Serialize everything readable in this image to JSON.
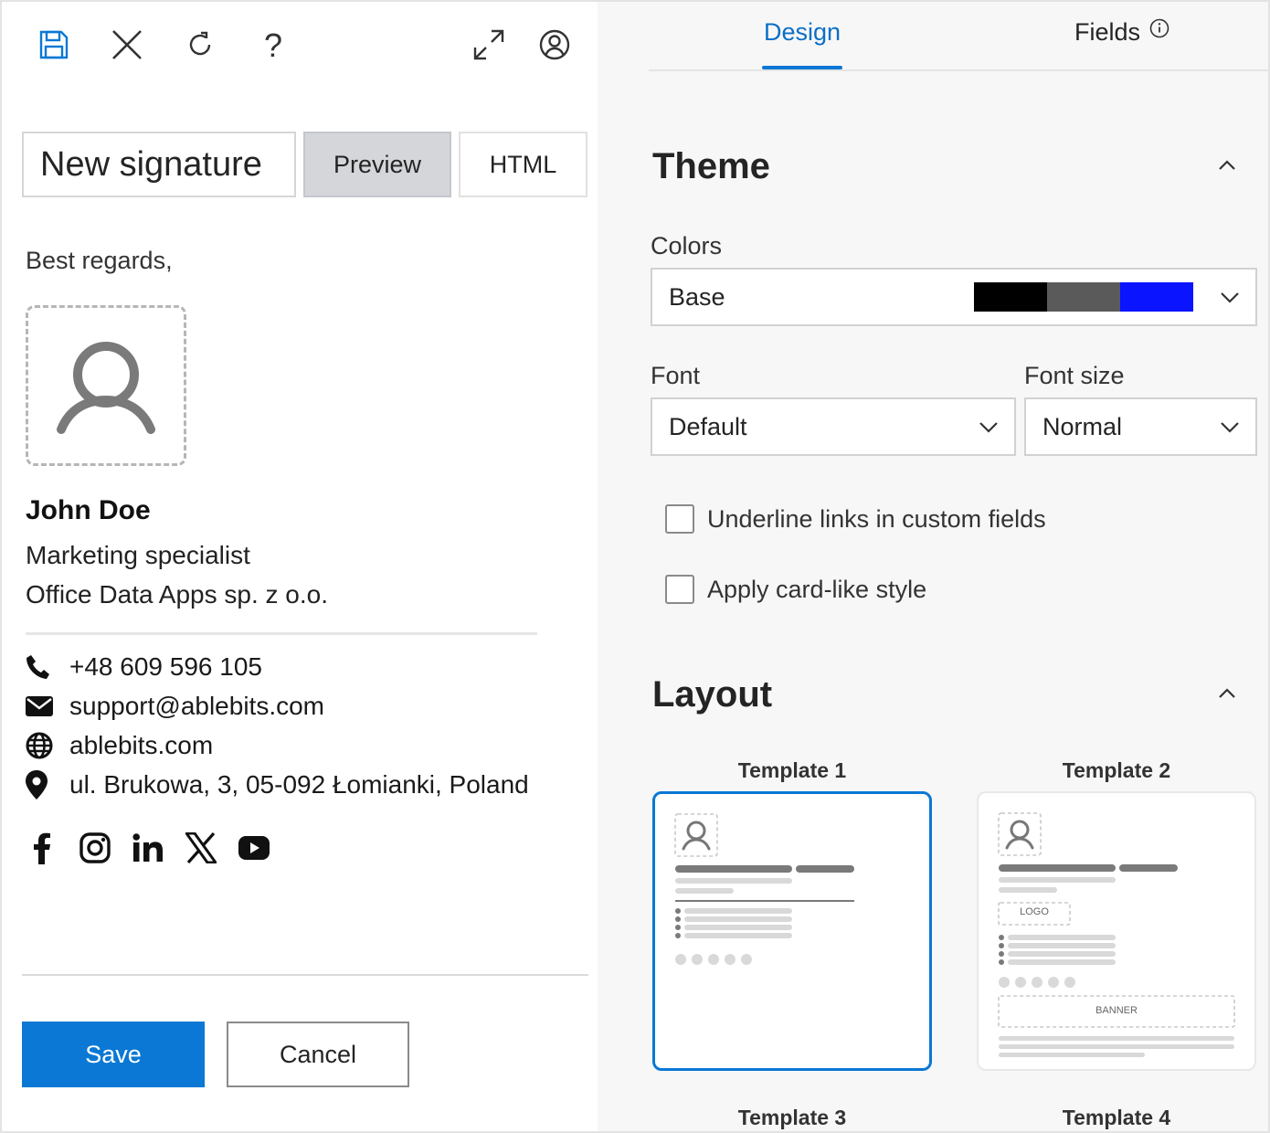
{
  "toolbar": {
    "save_icon": "save-icon",
    "close_icon": "close-icon",
    "refresh_icon": "refresh-icon",
    "help_icon": "help-icon",
    "expand_icon": "expand-icon",
    "account_icon": "account-icon"
  },
  "editor": {
    "signature_name": "New signature",
    "preview_label": "Preview",
    "html_label": "HTML"
  },
  "signature": {
    "greeting": "Best regards,",
    "name": "John Doe",
    "title": "Marketing specialist",
    "company": "Office Data Apps sp. z o.o.",
    "phone": "+48 609 596 105",
    "email": "support@ablebits.com",
    "website": "ablebits.com",
    "address": "ul. Brukowa, 3, 05-092 Łomianki, Poland",
    "socials": [
      "facebook-icon",
      "instagram-icon",
      "linkedin-icon",
      "x-icon",
      "youtube-icon"
    ]
  },
  "actions": {
    "save_label": "Save",
    "cancel_label": "Cancel"
  },
  "panel": {
    "tabs": [
      {
        "label": "Design",
        "active": true
      },
      {
        "label": "Fields",
        "active": false
      }
    ],
    "theme": {
      "title": "Theme",
      "colors_label": "Colors",
      "colors_value": "Base",
      "swatches": [
        "#000000",
        "#5a5a5a",
        "#0a14ff"
      ],
      "font_label": "Font",
      "font_value": "Default",
      "font_size_label": "Font size",
      "font_size_value": "Normal",
      "underline_label": "Underline links in custom fields",
      "underline_checked": false,
      "card_label": "Apply card-like style",
      "card_checked": false
    },
    "layout": {
      "title": "Layout",
      "templates": [
        {
          "label": "Template 1",
          "selected": true
        },
        {
          "label": "Template 2",
          "selected": false,
          "logo_text": "LOGO",
          "banner_text": "BANNER"
        },
        {
          "label": "Template 3"
        },
        {
          "label": "Template 4"
        }
      ]
    }
  },
  "colors": {
    "accent": "#0a78d4",
    "active_tab": "#0a6fc7"
  }
}
